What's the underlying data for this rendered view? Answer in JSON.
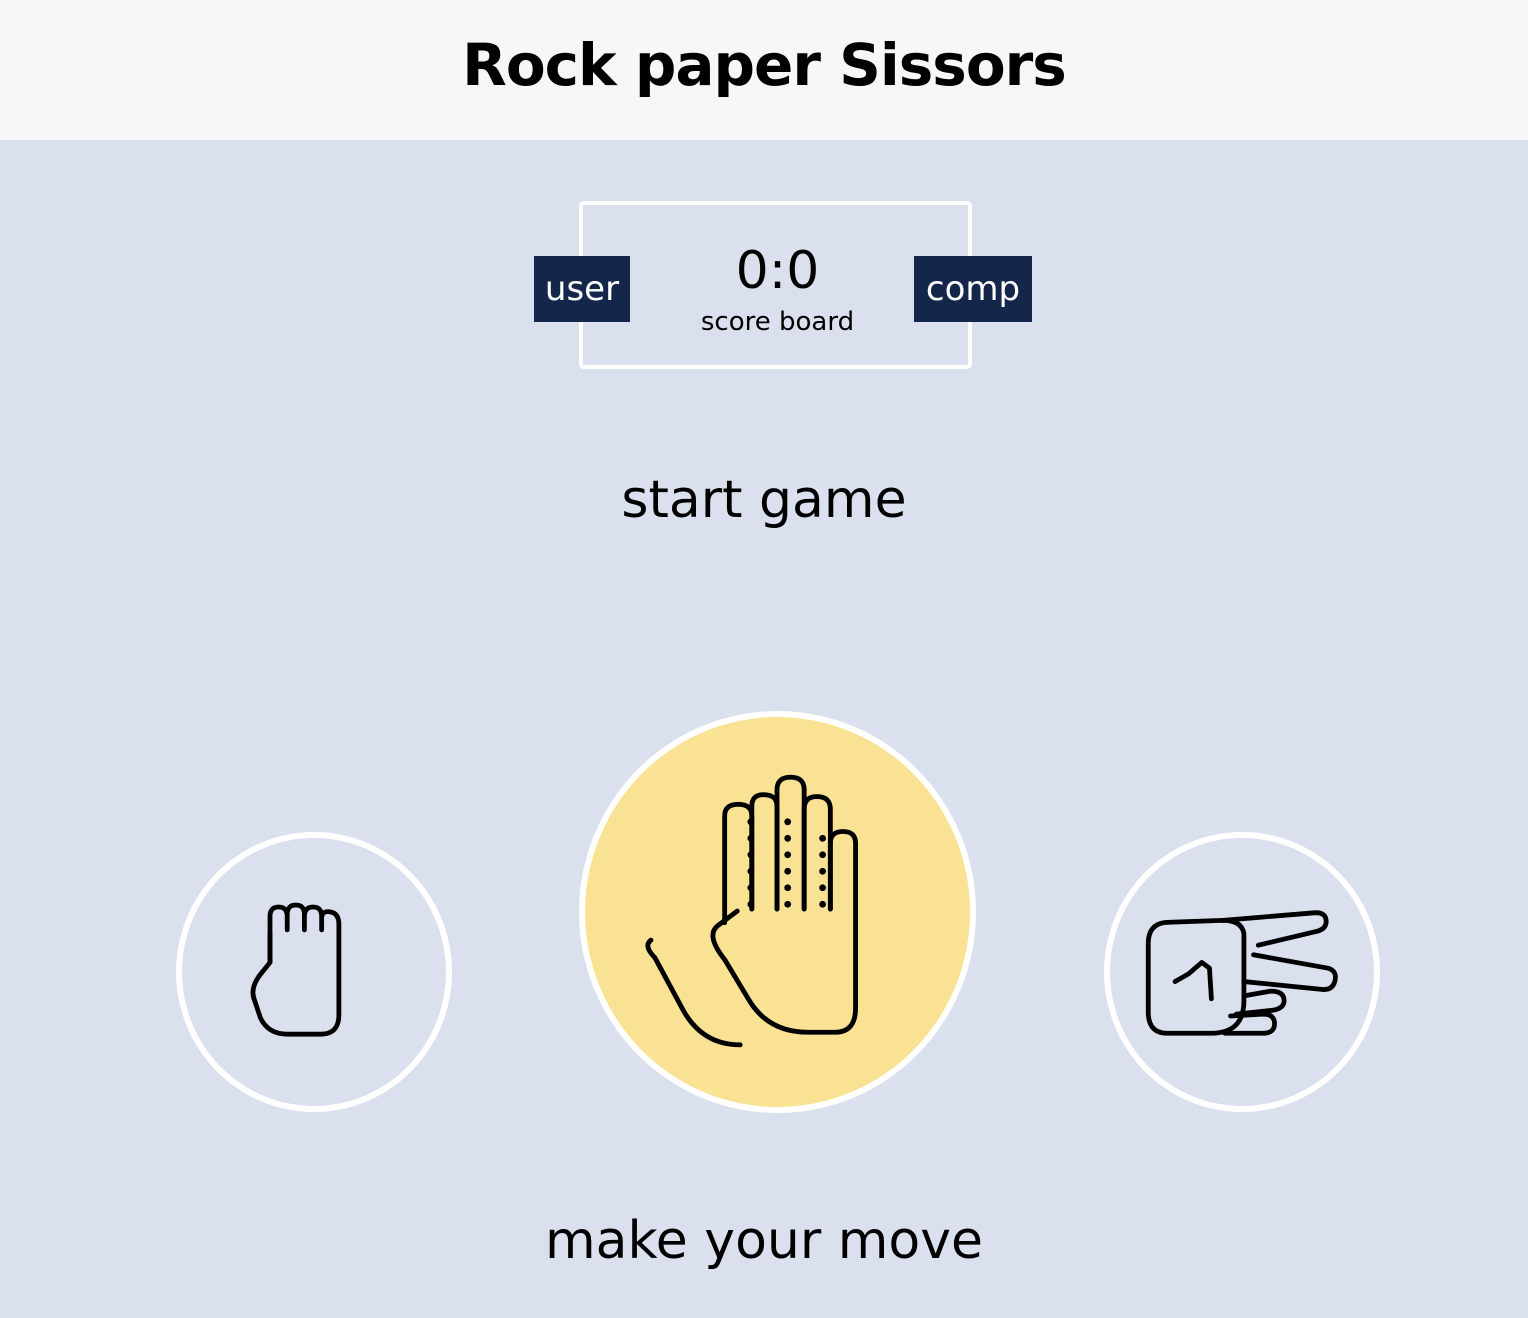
{
  "header": {
    "title": "Rock paper Sissors"
  },
  "scoreboard": {
    "user_label": "user",
    "comp_label": "comp",
    "score": "0:0",
    "caption": "score board"
  },
  "result_message": "start game",
  "choices": [
    {
      "id": "rock",
      "icon": "fist-icon"
    },
    {
      "id": "paper",
      "icon": "open-hand-icon",
      "highlighted": true,
      "highlight_color": "#fae294"
    },
    {
      "id": "scissors",
      "icon": "scissors-hand-icon"
    }
  ],
  "action_message": "make your move",
  "colors": {
    "background": "#dae0ee",
    "header_background": "#f8f6f8",
    "badge": "#14274a",
    "highlight": "#fae294",
    "border": "#ffffff"
  }
}
